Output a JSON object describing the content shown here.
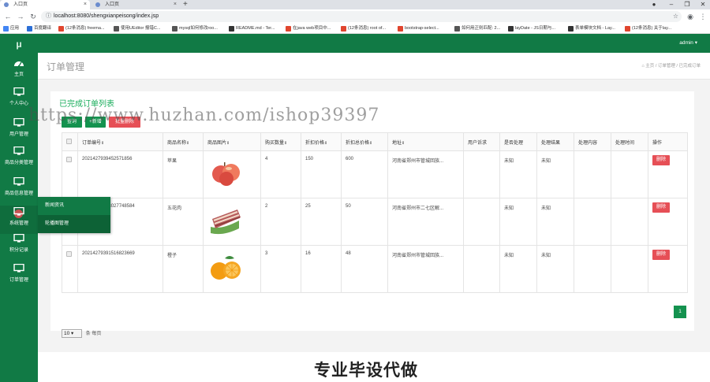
{
  "browser": {
    "tabs": [
      {
        "title": "入口页"
      },
      {
        "title": "入口页"
      }
    ],
    "url": "localhost:8080/shengxianpeisong/index.jsp",
    "bookmarks": [
      {
        "label": "应用",
        "color": "#4285f4"
      },
      {
        "label": "百度翻译",
        "color": "#2c6fd6"
      },
      {
        "label": "(12条消息) freema...",
        "color": "#e0452e"
      },
      {
        "label": "使用UEditor 报错C...",
        "color": "#555555"
      },
      {
        "label": "mysql如何修改roo...",
        "color": "#555555"
      },
      {
        "label": "README.md - Ter...",
        "color": "#333333"
      },
      {
        "label": "在java web项目中...",
        "color": "#e0452e"
      },
      {
        "label": "(12条消息) root of...",
        "color": "#e0452e"
      },
      {
        "label": "bootstrap-select...",
        "color": "#e0452e"
      },
      {
        "label": "如何用正则匹配: 2...",
        "color": "#555555"
      },
      {
        "label": "layDate - JS日期与...",
        "color": "#333333"
      },
      {
        "label": "表单模块文档 - Lay...",
        "color": "#333333"
      },
      {
        "label": "(12条消息) 关于lay...",
        "color": "#e0452e"
      }
    ]
  },
  "app": {
    "logo": "μ",
    "user": "admin ▾",
    "sidebar": [
      {
        "label": "主页",
        "icon": "dashboard-icon"
      },
      {
        "label": "个人中心",
        "icon": "monitor-icon"
      },
      {
        "label": "用户管理",
        "icon": "monitor-icon"
      },
      {
        "label": "商品分类管理",
        "icon": "monitor-icon"
      },
      {
        "label": "商品信息管理",
        "icon": "monitor-icon"
      },
      {
        "label": "系统管理",
        "icon": "monitor-icon"
      },
      {
        "label": "积分记录",
        "icon": "monitor-icon"
      },
      {
        "label": "订单管理",
        "icon": "monitor-icon"
      }
    ],
    "submenu": [
      {
        "label": "新闻资讯"
      },
      {
        "label": "轮播图管理"
      }
    ],
    "page_title": "订单管理",
    "breadcrumb": {
      "home": "主页",
      "sep": "/",
      "parent": "订单管理",
      "current": "已完成订单"
    },
    "card_title": "已完成订单列表",
    "buttons": {
      "search": "查询",
      "add": "+新增",
      "batch_delete": "批量删除"
    },
    "table": {
      "headers": [
        "订单编号",
        "商品名称",
        "商品图片",
        "购买数量",
        "折扣价格",
        "折扣总价格",
        "地址",
        "用户诉求",
        "是否处理",
        "处理结果",
        "处理内容",
        "处理时间",
        "操作"
      ],
      "rows": [
        {
          "order_no": "2021427939452571856",
          "name": "苹果",
          "image": "apple",
          "qty": "4",
          "price": "150",
          "total": "600",
          "address": "河南省郑州市管城回族...",
          "appeal": "",
          "handled": "未知",
          "result": "未知",
          "content": "",
          "time": "",
          "action": "删除"
        },
        {
          "order_no": "2021427939302774858​4",
          "name": "五花肉",
          "image": "pork",
          "qty": "2",
          "price": "25",
          "total": "50",
          "address": "河南省郑州市二七区解...",
          "appeal": "",
          "handled": "未知",
          "result": "未知",
          "content": "",
          "time": "",
          "action": "删除"
        },
        {
          "order_no": "2021427939151682366​9",
          "name": "橙子",
          "image": "orange",
          "qty": "3",
          "price": "16",
          "total": "48",
          "address": "河南省郑州市管城回族...",
          "appeal": "",
          "handled": "未知",
          "result": "未知",
          "content": "",
          "time": "",
          "action": "删除"
        }
      ]
    },
    "pagination": {
      "page_size": "10",
      "per_page_label": "条 每页",
      "current_page": "1"
    }
  },
  "overlay": {
    "watermark": "https://www.huzhan.com/ishop39397",
    "promo": "专业毕设代做"
  },
  "colors": {
    "primary": "#117a45",
    "danger": "#e64f56",
    "title_green": "#1aad5c"
  }
}
